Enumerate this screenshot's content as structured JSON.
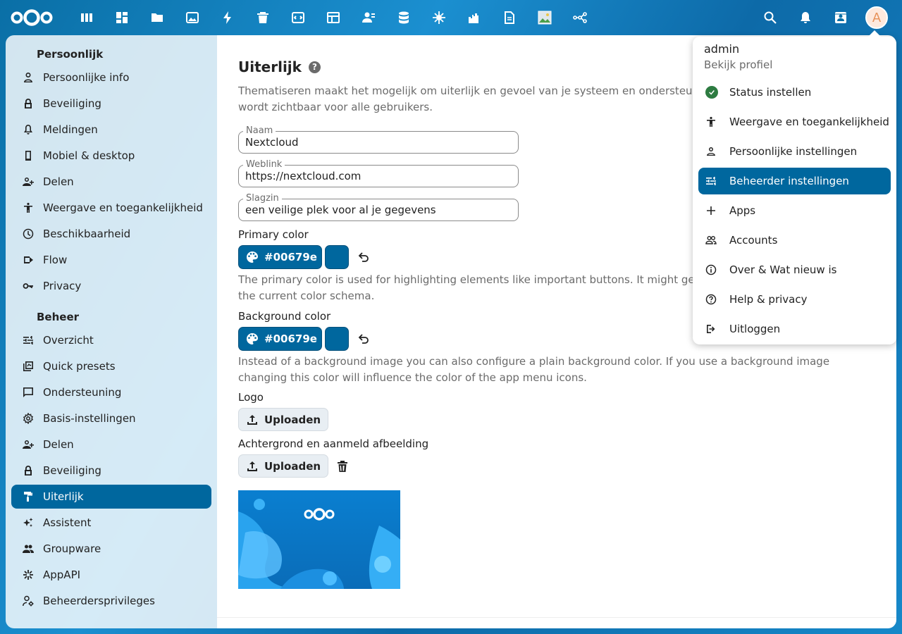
{
  "topbar": {
    "apps": [
      "dashboard-icon",
      "grid-icon",
      "folder-icon",
      "image-icon",
      "activity-icon",
      "trash-icon",
      "code-icon",
      "table-icon",
      "contacts-icon",
      "database-icon",
      "spider-icon",
      "castle-icon",
      "document-icon",
      "picture-icon",
      "flow-icon"
    ],
    "avatar_letter": "A"
  },
  "sidebar": {
    "personal_title": "Persoonlijk",
    "personal_items": [
      "Persoonlijke info",
      "Beveiliging",
      "Meldingen",
      "Mobiel & desktop",
      "Delen",
      "Weergave en toegankelijkheid",
      "Beschikbaarheid",
      "Flow",
      "Privacy"
    ],
    "admin_title": "Beheer",
    "admin_items": [
      "Overzicht",
      "Quick presets",
      "Ondersteuning",
      "Basis-instellingen",
      "Delen",
      "Beveiliging",
      "Uiterlijk",
      "Assistent",
      "Groupware",
      "AppAPI",
      "Beheerdersprivileges"
    ],
    "active_item": "Uiterlijk"
  },
  "main": {
    "title": "Uiterlijk",
    "description": "Thematiseren maakt het mogelijk om uiterlijk en gevoel van je systeem en ondersteu",
    "description2": "wordt zichtbaar voor alle gebruikers.",
    "name_label": "Naam",
    "name_value": "Nextcloud",
    "weblink_label": "Weblink",
    "weblink_value": "https://nextcloud.com",
    "slogan_label": "Slagzin",
    "slogan_value": "een veilige plek voor al je gegevens",
    "primary_label": "Primary color",
    "primary_value": "#00679e",
    "primary_desc": "The primary color is used for highlighting elements like important buttons. It might ge",
    "primary_desc2": "the current color schema.",
    "background_label": "Background color",
    "background_value": "#00679e",
    "background_desc": "Instead of a background image you can also configure a plain background color. If you use a background image",
    "background_desc2": "changing this color will influence the color of the app menu icons.",
    "logo_label": "Logo",
    "upload_label": "Uploaden",
    "bg_image_label": "Achtergrond en aanmeld afbeelding",
    "upload_label2": "Uploaden"
  },
  "menu": {
    "user": "admin",
    "profile": "Bekijk profiel",
    "items": [
      "Status instellen",
      "Weergave en toegankelijkheid",
      "Persoonlijke instellingen",
      "Beheerder instellingen",
      "Apps",
      "Accounts",
      "Over & Wat nieuw is",
      "Help & privacy",
      "Uitloggen"
    ],
    "active": "Beheerder instellingen"
  },
  "colors": {
    "primary": "#00679e",
    "status_online": "#2d7b41"
  }
}
